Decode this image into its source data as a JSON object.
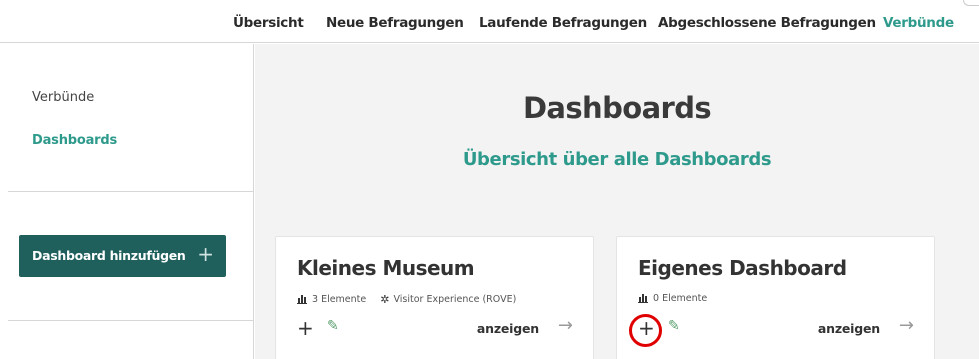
{
  "topnav": {
    "items": [
      {
        "label": "Übersicht"
      },
      {
        "label": "Neue Befragungen"
      },
      {
        "label": "Laufende Befragungen"
      },
      {
        "label": "Abgeschlossene Befragungen"
      },
      {
        "label": "Verbünde"
      }
    ],
    "active_index": 4
  },
  "sidebar": {
    "items": [
      {
        "label": "Verbünde"
      },
      {
        "label": "Dashboards"
      }
    ],
    "add_button_label": "Dashboard hinzufügen",
    "add_button_icon": "+"
  },
  "main": {
    "title": "Dashboards",
    "subtitle": "Übersicht über alle Dashboards"
  },
  "cards": [
    {
      "title": "Kleines Museum",
      "elements_text": "3 Elemente",
      "experience_text": "Visitor Experience (ROVE)",
      "add_icon": "+",
      "edit_icon": "✎",
      "show_label": "anzeigen",
      "arrow_icon": "→"
    },
    {
      "title": "Eigenes Dashboard",
      "elements_text": "0 Elemente",
      "add_icon": "+",
      "edit_icon": "✎",
      "show_label": "anzeigen",
      "arrow_icon": "→"
    }
  ],
  "colors": {
    "accent": "#2e9a8c",
    "button_bg": "#1f5f5c",
    "highlight": "#e00000"
  }
}
